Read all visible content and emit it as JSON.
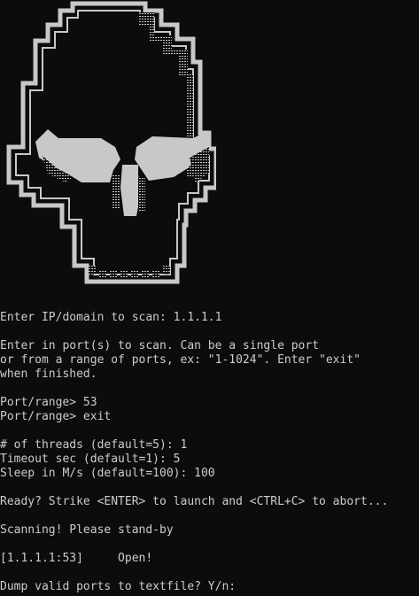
{
  "colors": {
    "background": "#0c0c0c",
    "text": "#cccccc",
    "ascii_art": "#c8c8c8"
  },
  "ascii_art": "skull",
  "output": {
    "target_prompt": "Enter IP/domain to scan: 1.1.1.1",
    "port_help_1": "Enter in port(s) to scan. Can be a single port",
    "port_help_2": "or from a range of ports, ex: \"1-1024\". Enter \"exit\"",
    "port_help_3": "when finished.",
    "port_entry_1": "Port/range> 53",
    "port_entry_2": "Port/range> exit",
    "threads": "# of threads (default=5): 1",
    "timeout": "Timeout sec (default=1): 5",
    "sleep": "Sleep in M/s (default=100): 100",
    "ready": "Ready? Strike <ENTER> to launch and <CTRL+C> to abort...",
    "scanning": "Scanning! Please stand-by",
    "result": "[1.1.1.1:53]     Open!",
    "dump_prompt": "Dump valid ports to textfile? Y/n:"
  }
}
